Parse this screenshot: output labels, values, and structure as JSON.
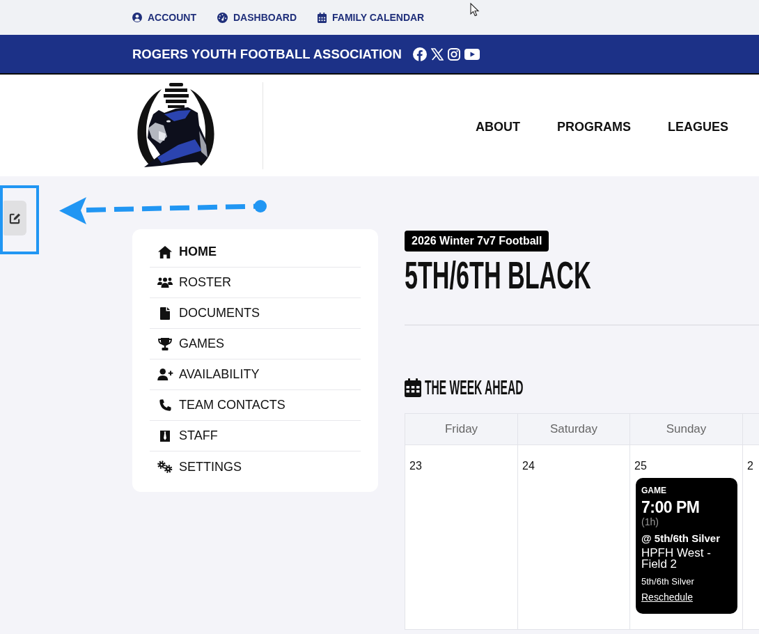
{
  "top_links": [
    {
      "label": "ACCOUNT"
    },
    {
      "label": "DASHBOARD"
    },
    {
      "label": "FAMILY CALENDAR"
    }
  ],
  "banner": {
    "title": "ROGERS YOUTH FOOTBALL ASSOCIATION"
  },
  "main_nav": [
    "ABOUT",
    "PROGRAMS",
    "LEAGUES"
  ],
  "sidebar": {
    "items": [
      {
        "label": "HOME",
        "selected": true
      },
      {
        "label": "ROSTER",
        "selected": false
      },
      {
        "label": "DOCUMENTS",
        "selected": false
      },
      {
        "label": "GAMES",
        "selected": false
      },
      {
        "label": "AVAILABILITY",
        "selected": false
      },
      {
        "label": "TEAM CONTACTS",
        "selected": false
      },
      {
        "label": "STAFF",
        "selected": false
      },
      {
        "label": "SETTINGS",
        "selected": false
      }
    ]
  },
  "team": {
    "season": "2026 Winter 7v7 Football",
    "name": "5TH/6TH BLACK"
  },
  "week": {
    "title": "THE WEEK AHEAD",
    "days": [
      {
        "name": "Friday",
        "date": "23"
      },
      {
        "name": "Saturday",
        "date": "24"
      },
      {
        "name": "Sunday",
        "date": "25",
        "events": [
          {
            "category": "GAME",
            "time": "7:00 PM",
            "duration": "(1h)",
            "opponent": "@ 5th/6th Silver",
            "location": "HPFH West - Field 2",
            "team": "5th/6th Silver",
            "action": "Reschedule"
          }
        ]
      },
      {
        "date": "2"
      }
    ]
  }
}
